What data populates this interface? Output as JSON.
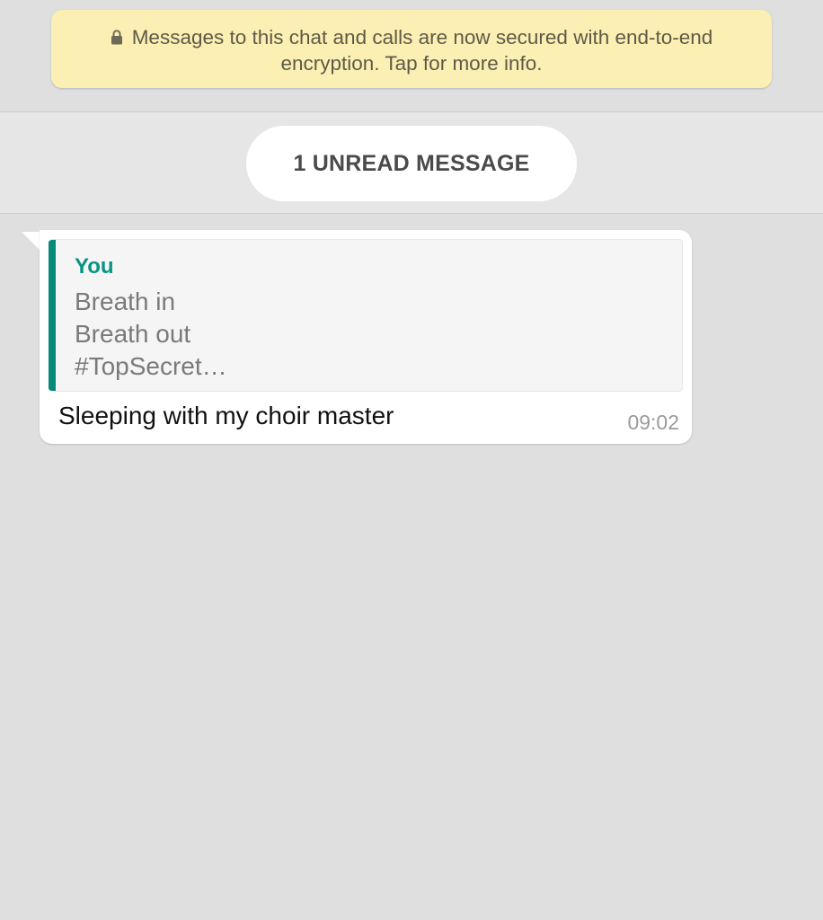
{
  "encryption_notice": {
    "text": "Messages to this chat and calls are now secured with end-to-end encryption. Tap for more info.",
    "icon": "lock-icon"
  },
  "unread_divider": {
    "label": "1 UNREAD MESSAGE"
  },
  "message": {
    "quoted": {
      "author": "You",
      "lines": [
        "Breath in",
        "Breath out",
        "#TopSecret…"
      ]
    },
    "text": "Sleeping with my choir master",
    "time": "09:02"
  },
  "colors": {
    "chat_background": "#dfdfdf",
    "notice_background": "#fbefb3",
    "bubble_background": "#ffffff",
    "quote_accent": "#078a7b",
    "quote_author": "#089484"
  }
}
